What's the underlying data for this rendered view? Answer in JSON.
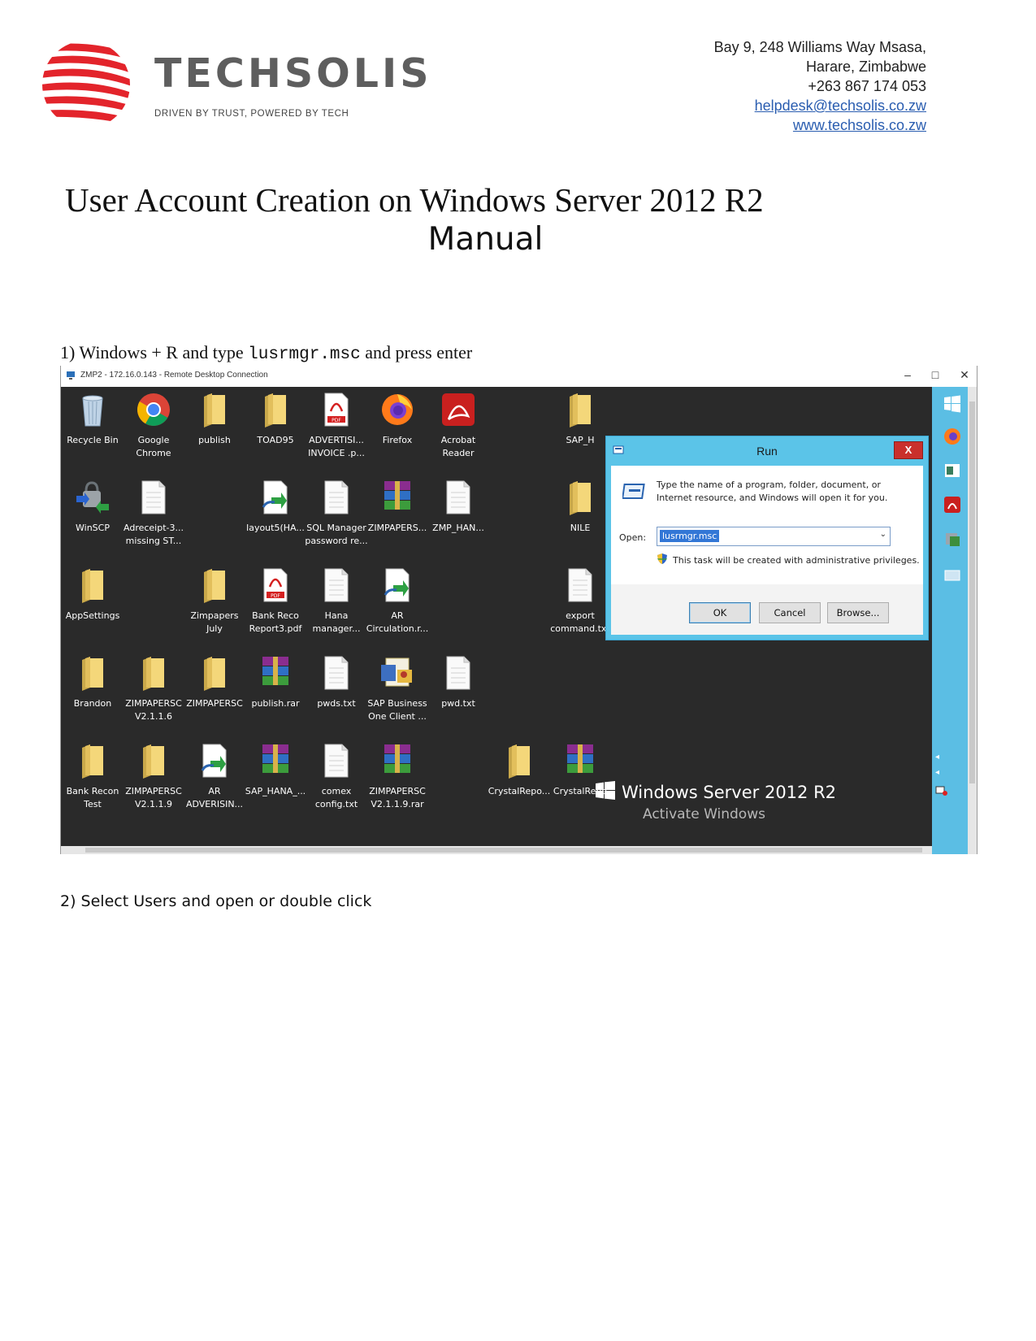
{
  "header": {
    "company": "TECHSOLIS",
    "tagline": "DRIVEN BY TRUST, POWERED BY TECH",
    "address_line1": "Bay 9, 248 Williams Way Msasa,",
    "address_line2": "Harare, Zimbabwe",
    "phone": "+263 867 174 053",
    "email": "helpdesk@techsolis.co.zw",
    "website": "www.techsolis.co.zw",
    "brand_color": "#e3242b"
  },
  "doc": {
    "title_line1": "User Account Creation on Windows Server 2012 R2",
    "title_line2": "Manual",
    "step1_prefix": "1) Windows + R and type ",
    "step1_code": "lusrmgr.msc",
    "step1_suffix": " and press enter",
    "step2": "2) Select Users and open or double click"
  },
  "rdp": {
    "window_title": "ZMP2 - 172.16.0.143 - Remote Desktop Connection",
    "minimize": "–",
    "maximize": "□",
    "close": "✕"
  },
  "desktop_icons": [
    {
      "label": "Recycle Bin",
      "icon": "recycle-bin-icon"
    },
    {
      "label": "Google Chrome",
      "icon": "chrome-icon"
    },
    {
      "label": "publish",
      "icon": "folder-icon"
    },
    {
      "label": "TOAD95",
      "icon": "folder-icon"
    },
    {
      "label": "ADVERTISI... INVOICE .p...",
      "icon": "pdf-icon"
    },
    {
      "label": "Firefox",
      "icon": "firefox-icon"
    },
    {
      "label": "Acrobat Reader",
      "icon": "acrobat-icon"
    },
    {
      "label": "SAP_H",
      "icon": "folder-icon"
    },
    {
      "label": "WinSCP",
      "icon": "winscp-icon"
    },
    {
      "label": "Adreceipt-3... missing ST...",
      "icon": "text-file-icon"
    },
    {
      "label": "layout5(HA...",
      "icon": "shortcut-icon"
    },
    {
      "label": "SQL Manager password re...",
      "icon": "text-file-icon"
    },
    {
      "label": "ZIMPAPERS...",
      "icon": "rar-icon"
    },
    {
      "label": "ZMP_HAN...",
      "icon": "text-file-icon"
    },
    {
      "label": "NILE",
      "icon": "folder-icon"
    },
    {
      "label": "AppSettings",
      "icon": "folder-icon"
    },
    {
      "label": "Zimpapers July",
      "icon": "folder-icon"
    },
    {
      "label": "Bank Reco Report3.pdf",
      "icon": "pdf-icon"
    },
    {
      "label": "Hana manager...",
      "icon": "text-file-icon"
    },
    {
      "label": "AR Circulation.r...",
      "icon": "shortcut-icon"
    },
    {
      "label": "export command.txt",
      "icon": "text-file-icon"
    },
    {
      "label": "Brandon",
      "icon": "folder-icon"
    },
    {
      "label": "ZIMPAPERSC V2.1.1.6",
      "icon": "folder-icon"
    },
    {
      "label": "ZIMPAPERSC",
      "icon": "folder-icon"
    },
    {
      "label": "publish.rar",
      "icon": "rar-icon"
    },
    {
      "label": "pwds.txt",
      "icon": "text-file-icon"
    },
    {
      "label": "SAP Business One Client ...",
      "icon": "sap-icon"
    },
    {
      "label": "pwd.txt",
      "icon": "text-file-icon"
    },
    {
      "label": "Bank Recon Test",
      "icon": "folder-icon"
    },
    {
      "label": "ZIMPAPERSC V2.1.1.9",
      "icon": "folder-icon"
    },
    {
      "label": "AR ADVERISIN...",
      "icon": "shortcut-icon"
    },
    {
      "label": "SAP_HANA_...",
      "icon": "rar-icon"
    },
    {
      "label": "comex config.txt",
      "icon": "text-file-icon"
    },
    {
      "label": "ZIMPAPERSC V2.1.1.9.rar",
      "icon": "rar-icon"
    },
    {
      "label": "CrystalRepo...",
      "icon": "folder-icon"
    },
    {
      "label": "CrystalRepo",
      "icon": "rar-icon"
    }
  ],
  "run_dialog": {
    "title": "Run",
    "close": "X",
    "description": "Type the name of a program, folder, document, or Internet resource, and Windows will open it for you.",
    "open_label": "Open:",
    "open_value": "lusrmgr.msc",
    "admin_note": "This task will be created with administrative privileges.",
    "ok": "OK",
    "cancel": "Cancel",
    "browse": "Browse..."
  },
  "watermark": {
    "product": "Windows Server 2012 R2",
    "activate": "Activate Windows"
  }
}
